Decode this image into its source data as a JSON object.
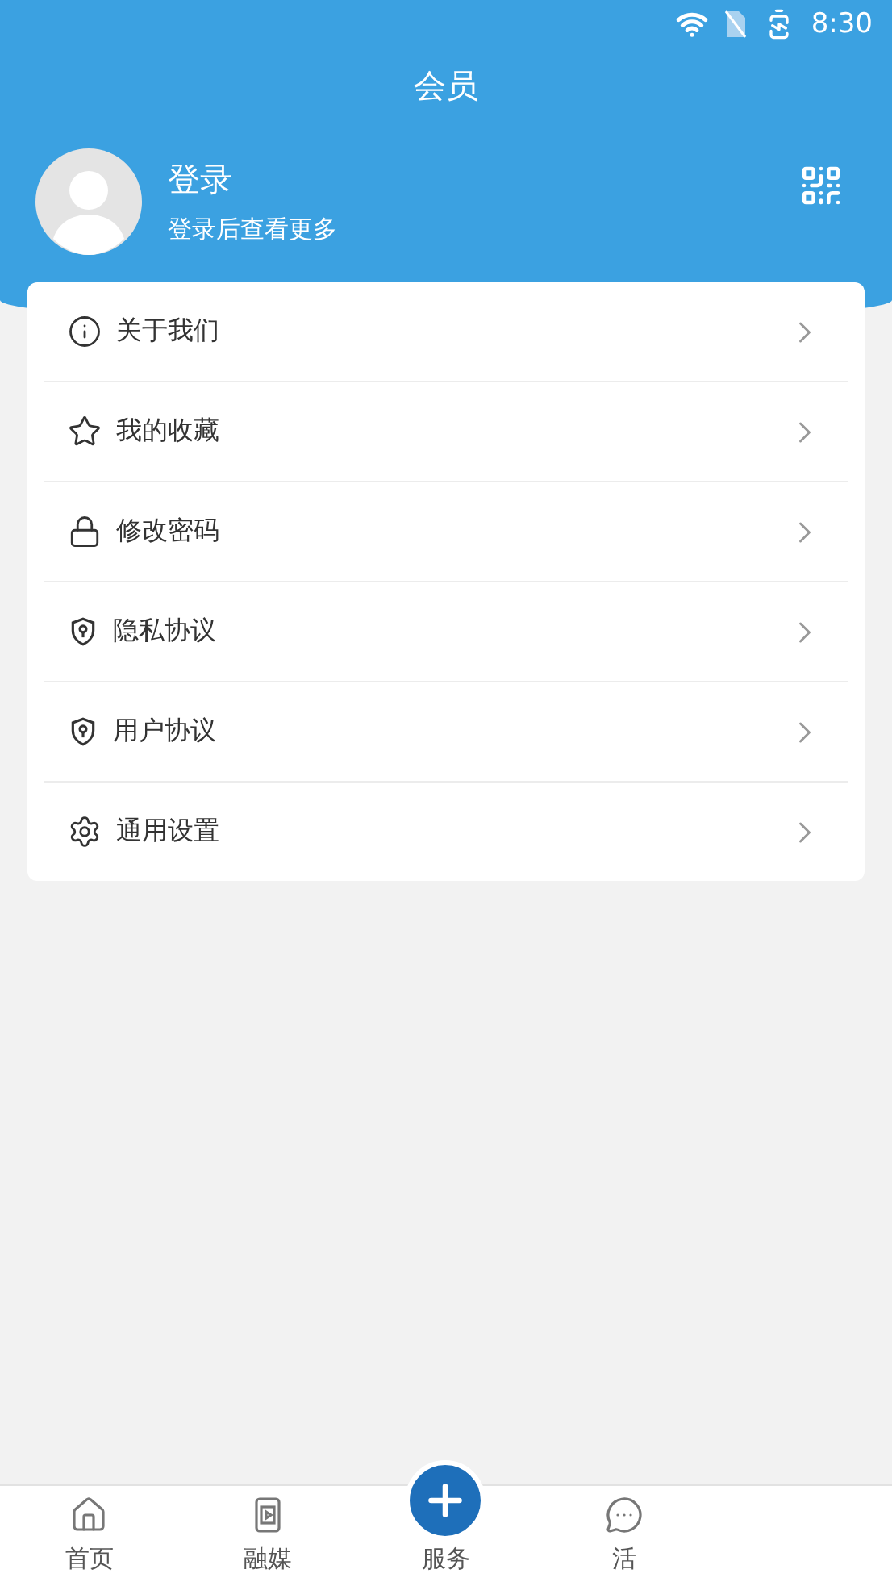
{
  "status_bar": {
    "time": "8:30"
  },
  "header": {
    "title": "会员"
  },
  "profile": {
    "name": "登录",
    "subtitle": "登录后查看更多"
  },
  "menu": [
    {
      "kind": "info",
      "label": "关于我们"
    },
    {
      "kind": "star",
      "label": "我的收藏"
    },
    {
      "kind": "lock",
      "label": "修改密码"
    },
    {
      "kind": "shield",
      "label": "隐私协议"
    },
    {
      "kind": "shield",
      "label": "用户协议"
    },
    {
      "kind": "gear",
      "label": "通用设置"
    }
  ],
  "tab_bar": [
    {
      "kind": "home",
      "label": "首页"
    },
    {
      "kind": "media",
      "label": "融媒"
    },
    {
      "kind": "plus",
      "label": "服务"
    },
    {
      "kind": "chat",
      "label": "活"
    }
  ]
}
